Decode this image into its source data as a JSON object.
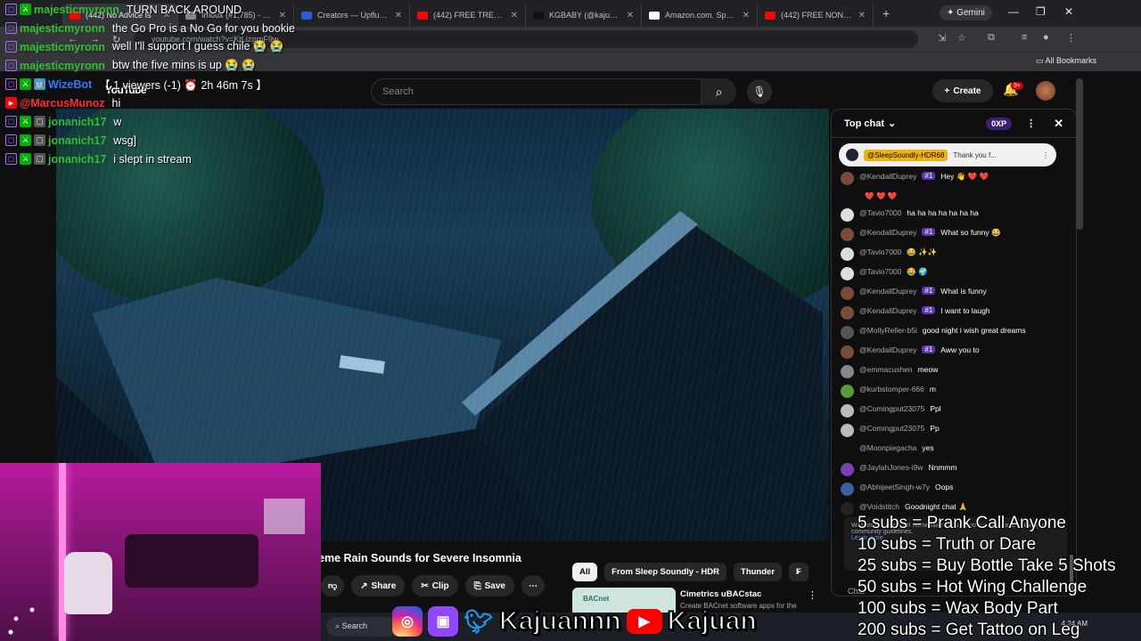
{
  "browser": {
    "tabs": [
      {
        "title": "(442) No Advice Is",
        "favicon_color": "#ff0000",
        "active": true
      },
      {
        "title": "Imoux (#1,785) - Kgames",
        "favicon_color": "#888888",
        "active": false
      },
      {
        "title": "Creators — Upfluence",
        "favicon_color": "#2a5bd7",
        "active": false
      },
      {
        "title": "(442) FREE TRENDING",
        "favicon_color": "#ff0000",
        "active": false
      },
      {
        "title": "KGBABY (@kajuannn)",
        "favicon_color": "#111111",
        "active": false
      },
      {
        "title": "Amazon.com. Spend le",
        "favicon_color": "#ffffff",
        "active": false
      },
      {
        "title": "(442) FREE NON COPY",
        "favicon_color": "#ff0000",
        "active": false
      }
    ],
    "gemini_label": "Gemini",
    "url": "youtube.com/watch?v=KtLizgrpF9w",
    "all_bookmarks": "All Bookmarks"
  },
  "youtube": {
    "logo": "YouTube",
    "search_placeholder": "Search",
    "create_label": "Create",
    "notif_count": "9+",
    "video_title": "eme Rain Sounds for Severe Insomnia",
    "actions": {
      "share": "Share",
      "clip": "Clip",
      "save": "Save"
    },
    "chips": [
      "All",
      "From Sleep Soundly - HDR",
      "Thunder",
      "F"
    ],
    "rec": {
      "thumb_label": "BACnet",
      "title": "Cimetrics uBACstac",
      "subtitle": "Create BACnet software apps for the"
    },
    "taskbar_search": "Search"
  },
  "live_chat": {
    "header": "Top chat",
    "xp": "0XP",
    "pinned": {
      "user": "@SleepSoundly-HDR68",
      "text": "Thank you f..."
    },
    "messages": [
      {
        "user": "@KendallDuprey",
        "member": "#1",
        "text": "Hey 👋 ❤️ ❤️",
        "color": "#7a4a3a"
      },
      {
        "user": "",
        "member": "",
        "text": "❤️ ❤️ ❤️",
        "color": "transparent"
      },
      {
        "user": "@Tavio7000",
        "member": "",
        "text": "ha ha ha ha ha ha ha",
        "color": "#ddd"
      },
      {
        "user": "@KendallDuprey",
        "member": "#1",
        "text": "What so funny 😂",
        "color": "#7a4a3a"
      },
      {
        "user": "@Tavio7000",
        "member": "",
        "text": "😂 ✨✨",
        "color": "#ddd"
      },
      {
        "user": "@Tavio7000",
        "member": "",
        "text": "😂 🌍",
        "color": "#ddd"
      },
      {
        "user": "@KendallDuprey",
        "member": "#1",
        "text": "What is funny",
        "color": "#7a4a3a"
      },
      {
        "user": "@KendallDuprey",
        "member": "#1",
        "text": "I want to laugh",
        "color": "#7a4a3a"
      },
      {
        "user": "@MollyReller-b5i",
        "member": "",
        "text": "good night i wish great dreams",
        "color": "#555"
      },
      {
        "user": "@KendallDuprey",
        "member": "#1",
        "text": "Aww you to",
        "color": "#7a4a3a"
      },
      {
        "user": "@emmacushen",
        "member": "",
        "text": "meow",
        "color": "#888"
      },
      {
        "user": "@kurbstomper-666",
        "member": "",
        "text": "m",
        "color": "#5a9a3a"
      },
      {
        "user": "@Comingput23075",
        "member": "",
        "text": "Ppl",
        "color": "#bbb"
      },
      {
        "user": "@Comingput23075",
        "member": "",
        "text": "Pp",
        "color": "#bbb"
      },
      {
        "user": "@Moonpiegacha",
        "member": "",
        "text": "yes",
        "color": "transparent"
      },
      {
        "user": "@JaylahJones-i9w",
        "member": "",
        "text": "Nnmmm",
        "color": "#7b3fb5"
      },
      {
        "user": "@AbhijeetSingh-w7y",
        "member": "",
        "text": "Oops",
        "color": "#3a5fa5"
      },
      {
        "user": "@Voidstitch",
        "member": "",
        "text": "Goodnight chat 🙏",
        "color": "#222"
      }
    ],
    "notice": "Welcome to live chat! Remember to guard your privacy and abide by our community guidelines.",
    "learn_more": "Learn more",
    "chat_label": "Chat"
  },
  "stream_chat": [
    {
      "badges": [
        "tw",
        "mod"
      ],
      "name": "majesticmyronn",
      "name_color": "#2fbf2f",
      "text": "TURN BACK AROUND"
    },
    {
      "badges": [
        "tw"
      ],
      "name": "majesticmyronn",
      "name_color": "#2fbf2f",
      "text": "the Go Pro is a No Go for you bookie"
    },
    {
      "badges": [
        "tw"
      ],
      "name": "majesticmyronn",
      "name_color": "#2fbf2f",
      "text": "well I'll support I guess chile 😭 😭"
    },
    {
      "badges": [
        "tw"
      ],
      "name": "majesticmyronn",
      "name_color": "#2fbf2f",
      "text": "btw the five mins is up 😭 😭"
    },
    {
      "badges": [
        "tw",
        "mod",
        "bot"
      ],
      "name": "WizeBot",
      "name_color": "#2f7bff",
      "text": "【 1 viewers (-1) ⏰ 2h 46m 7s 】"
    },
    {
      "badges": [
        "yt"
      ],
      "name": "@MarcusMunoz",
      "name_color": "#ff2b2b",
      "text": "hi"
    },
    {
      "badges": [
        "tw",
        "mod",
        "gr"
      ],
      "name": "jonanich17",
      "name_color": "#33bb33",
      "text": "w"
    },
    {
      "badges": [
        "tw",
        "mod",
        "gr"
      ],
      "name": "jonanich17",
      "name_color": "#33bb33",
      "text": "wsg]"
    },
    {
      "badges": [
        "tw",
        "mod",
        "gr"
      ],
      "name": "jonanich17",
      "name_color": "#33bb33",
      "text": "i slept in stream"
    }
  ],
  "socials": {
    "handle1": "Kajuannn",
    "handle2": "Kajuan"
  },
  "sub_goals": [
    "5 subs = Prank Call Anyone",
    "10 subs = Truth or Dare",
    "25 subs = Buy Bottle Take 5 Shots",
    "50 subs = Hot Wing Challenge",
    "100 subs = Wax Body Part",
    "200 subs = Get Tattoo on Leg"
  ],
  "clock": {
    "time": "4:24 AM"
  }
}
